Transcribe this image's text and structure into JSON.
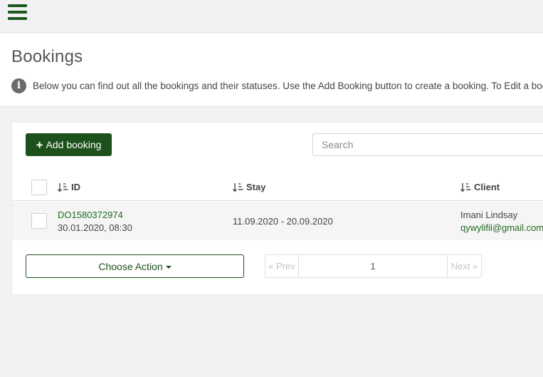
{
  "menu": {
    "icon": "hamburger-menu-icon"
  },
  "header": {
    "title": "Bookings",
    "info_icon": "info-circle-icon",
    "info_text": "Below you can find out all the bookings and their statuses. Use the Add Booking button to create a booking. To Edit a booking"
  },
  "toolbar": {
    "add_label": "Add booking",
    "add_icon": "plus-icon",
    "search_placeholder": "Search"
  },
  "table": {
    "columns": [
      {
        "label": "ID",
        "icon": "sort-icon"
      },
      {
        "label": "Stay",
        "icon": "sort-icon"
      },
      {
        "label": "Client",
        "icon": "sort-icon"
      }
    ],
    "rows": [
      {
        "id": "DO1580372974",
        "created": "30.01.2020, 08:30",
        "stay": "11.09.2020 - 20.09.2020",
        "client_name": "Imani Lindsay",
        "client_email": "qywylifil@gmail.com"
      }
    ]
  },
  "footer": {
    "choose_action_label": "Choose Action",
    "pagination": {
      "prev": "« Prev",
      "page": "1",
      "next": "Next »"
    }
  },
  "colors": {
    "brand_green": "#1c511c",
    "link_green": "#1f6a1f",
    "background": "#f2f2f4"
  }
}
